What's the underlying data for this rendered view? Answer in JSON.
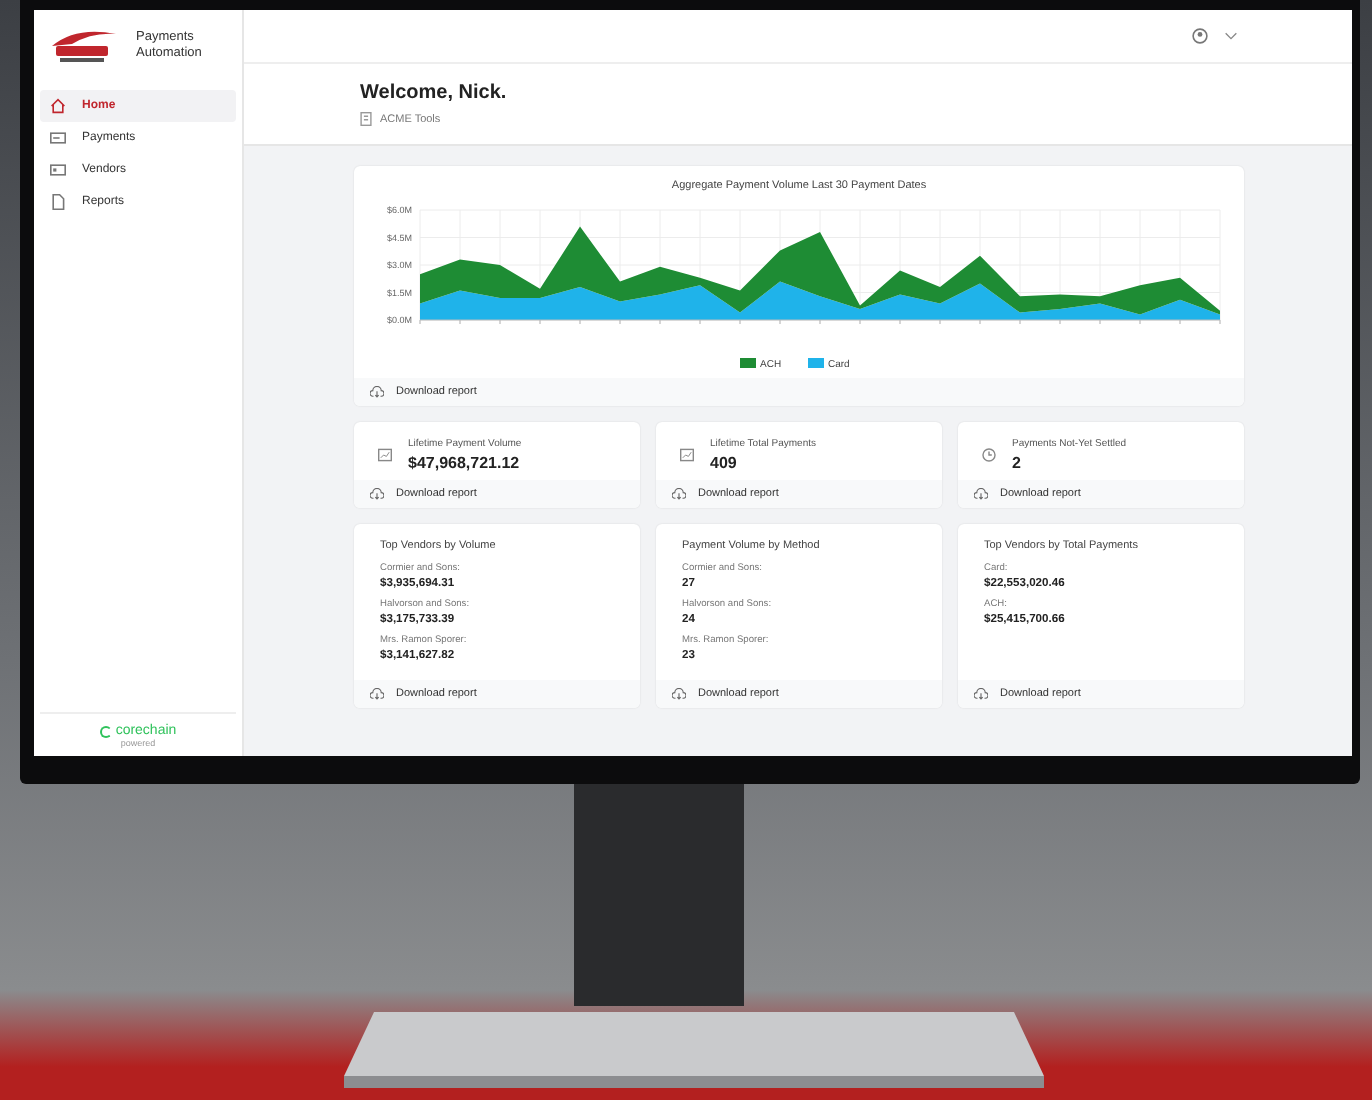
{
  "sidebar": {
    "app_name": "Payments Automation",
    "items": [
      {
        "label": "Home",
        "kind": "home",
        "selected": true
      },
      {
        "label": "Payments",
        "kind": "card",
        "selected": false
      },
      {
        "label": "Vendors",
        "kind": "id",
        "selected": false
      },
      {
        "label": "Reports",
        "kind": "doc",
        "selected": false
      }
    ],
    "footer": {
      "brand": "corechain",
      "tagline": "powered"
    }
  },
  "header": {
    "greeting": "Welcome, Nick.",
    "company": "ACME Tools"
  },
  "chart_card": {
    "chart_data": {
      "type": "area",
      "title": "Aggregate Payment Volume Last 30 Payment Dates",
      "stacked": true,
      "grid": true,
      "legend": true,
      "ylim": [
        0,
        6
      ],
      "yticks": [
        {
          "value": 0,
          "label": "$0.0M"
        },
        {
          "value": 1.5,
          "label": "$1.5M"
        },
        {
          "value": 3,
          "label": "$3.0M"
        },
        {
          "value": 4.5,
          "label": "$4.5M"
        },
        {
          "value": 6,
          "label": "$6.0M"
        }
      ],
      "series": [
        {
          "name": "ACH",
          "color": "#1e8c34",
          "values": [
            1.6,
            1.7,
            1.8,
            0.5,
            3.3,
            1.1,
            1.5,
            0.4,
            1.2,
            1.7,
            3.5,
            0.2,
            1.3,
            0.9,
            1.5,
            0.9,
            0.8,
            0.4,
            1.6,
            1.2,
            0.2
          ]
        },
        {
          "name": "Card",
          "color": "#1fb3ea",
          "values": [
            0.9,
            1.6,
            1.2,
            1.2,
            1.8,
            1.0,
            1.4,
            1.9,
            0.4,
            2.1,
            1.3,
            0.6,
            1.4,
            0.9,
            2.0,
            0.4,
            0.6,
            0.9,
            0.3,
            1.1,
            0.3
          ]
        }
      ]
    },
    "action": "Download report"
  },
  "stats": [
    {
      "label": "Lifetime Payment Volume",
      "value": "$47,968,721.12",
      "kind": "chart",
      "action": "Download report"
    },
    {
      "label": "Lifetime Total Payments",
      "value": "409",
      "kind": "chart",
      "action": "Download report"
    },
    {
      "label": "Payments Not-Yet Settled",
      "value": "2",
      "kind": "clock",
      "action": "Download report"
    }
  ],
  "lists": [
    {
      "title": "Top Vendors by Volume",
      "entries": [
        {
          "name": "Cormier and Sons:",
          "value": "$3,935,694.31"
        },
        {
          "name": "Halvorson and Sons:",
          "value": "$3,175,733.39"
        },
        {
          "name": "Mrs. Ramon Sporer:",
          "value": "$3,141,627.82"
        }
      ],
      "action": "Download report"
    },
    {
      "title": "Payment Volume by Method",
      "entries": [
        {
          "name": "Cormier and Sons:",
          "value": "27"
        },
        {
          "name": "Halvorson and Sons:",
          "value": "24"
        },
        {
          "name": "Mrs. Ramon Sporer:",
          "value": "23"
        }
      ],
      "action": "Download report"
    },
    {
      "title": "Top Vendors by Total Payments",
      "entries": [
        {
          "name": "Card:",
          "value": "$22,553,020.46"
        },
        {
          "name": "ACH:",
          "value": "$25,415,700.66"
        }
      ],
      "action": "Download report"
    }
  ]
}
